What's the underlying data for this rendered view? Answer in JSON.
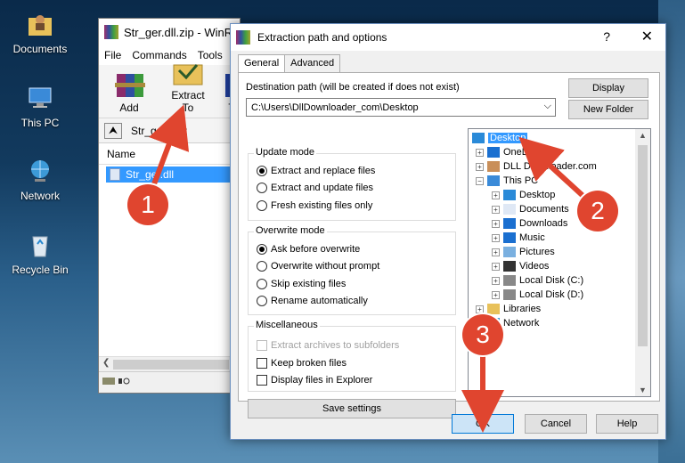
{
  "desktop": {
    "icons": [
      {
        "label": "Documents",
        "icon": "folder-user-icon"
      },
      {
        "label": "This PC",
        "icon": "computer-icon"
      },
      {
        "label": "Network",
        "icon": "network-icon"
      },
      {
        "label": "Recycle Bin",
        "icon": "recycle-bin-icon"
      }
    ]
  },
  "winrar": {
    "title": "Str_ger.dll.zip - WinR",
    "menu": [
      "File",
      "Commands",
      "Tools"
    ],
    "toolbar": {
      "add_label": "Add",
      "extract_label": "Extract To",
      "third_label": "T"
    },
    "path": "Str_ger.dll.z",
    "column_name": "Name",
    "file": "Str_ger.dll"
  },
  "dialog": {
    "title": "Extraction path and options",
    "help": "?",
    "close": "✕",
    "tabs": [
      "General",
      "Advanced"
    ],
    "dest_label": "Destination path (will be created if does not exist)",
    "dest_value": "C:\\Users\\DllDownloader_com\\Desktop",
    "display_button": "Display",
    "new_folder_button": "New Folder",
    "update_mode": {
      "title": "Update mode",
      "options": [
        "Extract and replace files",
        "Extract and update files",
        "Fresh existing files only"
      ],
      "selected": 0
    },
    "overwrite_mode": {
      "title": "Overwrite mode",
      "options": [
        "Ask before overwrite",
        "Overwrite without prompt",
        "Skip existing files",
        "Rename automatically"
      ],
      "selected": 0
    },
    "misc": {
      "title": "Miscellaneous",
      "options": [
        "Extract archives to subfolders",
        "Keep broken files",
        "Display files in Explorer"
      ]
    },
    "save_settings": "Save settings",
    "tree": [
      {
        "label": "Desktop",
        "level": 0,
        "icon": "desktop-icon",
        "selected": true
      },
      {
        "label": "OneDrive",
        "level": 1,
        "icon": "onedrive-icon"
      },
      {
        "label": "DLL Downloader.com",
        "level": 1,
        "icon": "user-icon"
      },
      {
        "label": "This PC",
        "level": 1,
        "icon": "computer-icon"
      },
      {
        "label": "Desktop",
        "level": 2,
        "icon": "desktop-icon"
      },
      {
        "label": "Documents",
        "level": 2,
        "icon": "documents-icon"
      },
      {
        "label": "Downloads",
        "level": 2,
        "icon": "downloads-icon"
      },
      {
        "label": "Music",
        "level": 2,
        "icon": "music-icon"
      },
      {
        "label": "Pictures",
        "level": 2,
        "icon": "pictures-icon"
      },
      {
        "label": "Videos",
        "level": 2,
        "icon": "videos-icon"
      },
      {
        "label": "Local Disk (C:)",
        "level": 2,
        "icon": "drive-icon"
      },
      {
        "label": "Local Disk (D:)",
        "level": 2,
        "icon": "drive-icon"
      },
      {
        "label": "Libraries",
        "level": 1,
        "icon": "libraries-icon"
      },
      {
        "label": "Network",
        "level": 1,
        "icon": "network-icon"
      }
    ],
    "ok_button": "OK",
    "cancel_button": "Cancel",
    "help_button": "Help"
  },
  "annotations": {
    "step1": "1",
    "step2": "2",
    "step3": "3",
    "color": "#e0452f"
  }
}
